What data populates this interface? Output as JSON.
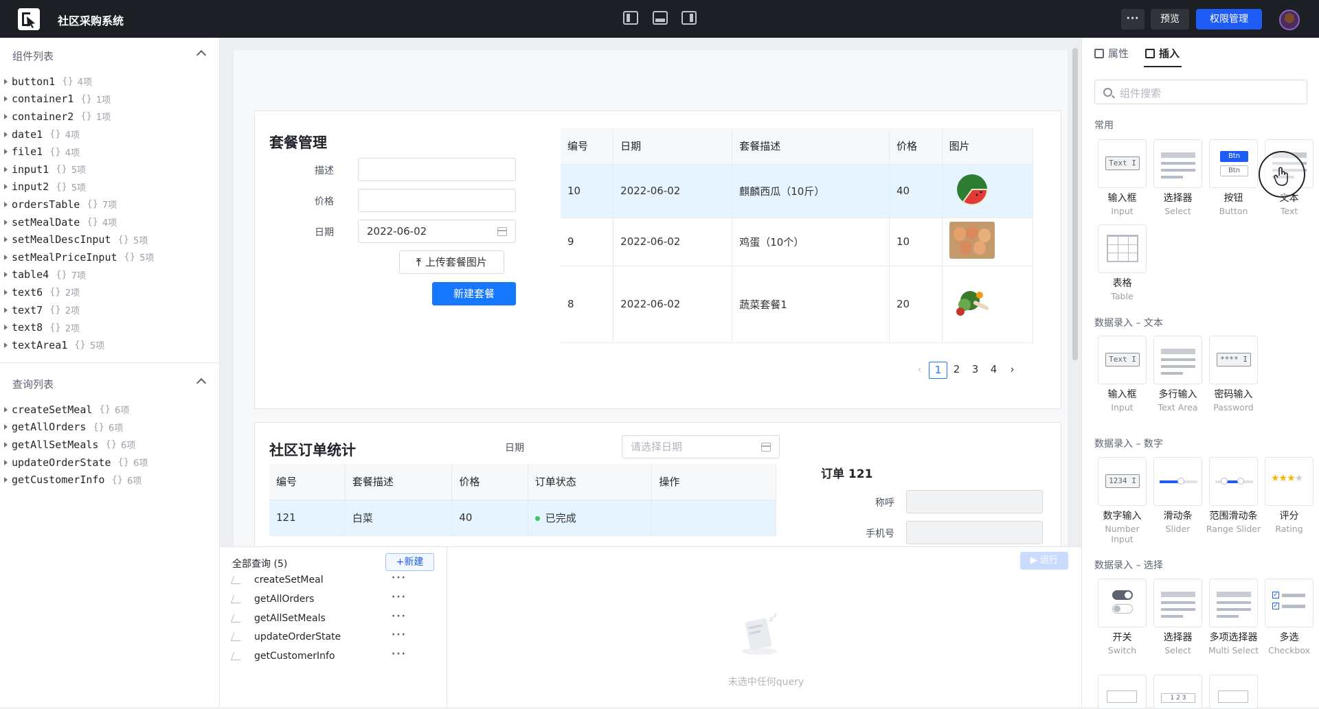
{
  "app": {
    "title": "社区采购系统"
  },
  "topbar": {
    "preview": "预览",
    "permissions": "权限管理",
    "more": "···"
  },
  "left": {
    "components_header": "组件列表",
    "components": [
      {
        "name": "button1",
        "count": "4项"
      },
      {
        "name": "container1",
        "count": "1项"
      },
      {
        "name": "container2",
        "count": "1项"
      },
      {
        "name": "date1",
        "count": "4项"
      },
      {
        "name": "file1",
        "count": "4项"
      },
      {
        "name": "input1",
        "count": "5项"
      },
      {
        "name": "input2",
        "count": "5项"
      },
      {
        "name": "ordersTable",
        "count": "7项"
      },
      {
        "name": "setMealDate",
        "count": "4项"
      },
      {
        "name": "setMealDescInput",
        "count": "5项"
      },
      {
        "name": "setMealPriceInput",
        "count": "5项"
      },
      {
        "name": "table4",
        "count": "7项"
      },
      {
        "name": "text6",
        "count": "2项"
      },
      {
        "name": "text7",
        "count": "2项"
      },
      {
        "name": "text8",
        "count": "2项"
      },
      {
        "name": "textArea1",
        "count": "5项"
      }
    ],
    "queries_header": "查询列表",
    "queries": [
      {
        "name": "createSetMeal",
        "count": "6项"
      },
      {
        "name": "getAllOrders",
        "count": "6项"
      },
      {
        "name": "getAllSetMeals",
        "count": "6项"
      },
      {
        "name": "updateOrderState",
        "count": "6项"
      },
      {
        "name": "getCustomerInfo",
        "count": "6项"
      }
    ],
    "brace": "{}"
  },
  "setmeal": {
    "title": "套餐管理",
    "desc_label": "描述",
    "price_label": "价格",
    "date_label": "日期",
    "date_value": "2022-06-02",
    "upload_label": "上传套餐图片",
    "create_label": "新建套餐",
    "columns": [
      "编号",
      "日期",
      "套餐描述",
      "价格",
      "图片"
    ],
    "rows": [
      {
        "id": "10",
        "date": "2022-06-02",
        "desc": "麒麟西瓜（10斤）",
        "price": "40"
      },
      {
        "id": "9",
        "date": "2022-06-02",
        "desc": "鸡蛋（10个）",
        "price": "10"
      },
      {
        "id": "8",
        "date": "2022-06-02",
        "desc": "蔬菜套餐1",
        "price": "20"
      }
    ],
    "pages": [
      "1",
      "2",
      "3",
      "4"
    ],
    "current_page": "1"
  },
  "orders": {
    "title": "社区订单统计",
    "date_label": "日期",
    "date_placeholder": "请选择日期",
    "columns": [
      "编号",
      "套餐描述",
      "价格",
      "订单状态",
      "操作"
    ],
    "rows": [
      {
        "id": "121",
        "desc": "白菜",
        "price": "40",
        "status": "已完成"
      }
    ],
    "detail_title": "订单 121",
    "name_label": "称呼",
    "phone_label": "手机号"
  },
  "queries_panel": {
    "title": "全部查询 (5)",
    "new_label": "+新建",
    "run_label": "▶ 运行",
    "items": [
      "createSetMeal",
      "getAllOrders",
      "getAllSetMeals",
      "updateOrderState",
      "getCustomerInfo"
    ],
    "empty_text": "未选中任何query"
  },
  "right": {
    "tab_props": "属性",
    "tab_insert": "插入",
    "search_placeholder": "组件搜索",
    "groups": {
      "common": "常用",
      "text_entry": "数据录入 – 文本",
      "number_entry": "数据录入 – 数字",
      "select_entry": "数据录入 – 选择"
    },
    "common": [
      {
        "zh": "输入框",
        "en": "Input",
        "icon": "text-input-icon"
      },
      {
        "zh": "选择器",
        "en": "Select",
        "icon": "select-icon"
      },
      {
        "zh": "按钮",
        "en": "Button",
        "icon": "button-icon"
      },
      {
        "zh": "文本",
        "en": "Text",
        "icon": "text-icon"
      },
      {
        "zh": "表格",
        "en": "Table",
        "icon": "table-icon"
      }
    ],
    "text_entry": [
      {
        "zh": "输入框",
        "en": "Input"
      },
      {
        "zh": "多行输入",
        "en": "Text Area"
      },
      {
        "zh": "密码输入",
        "en": "Password"
      }
    ],
    "number_entry": [
      {
        "zh": "数字输入",
        "en": "Number Input"
      },
      {
        "zh": "滑动条",
        "en": "Slider"
      },
      {
        "zh": "范围滑动条",
        "en": "Range Slider"
      },
      {
        "zh": "评分",
        "en": "Rating"
      }
    ],
    "select_entry": [
      {
        "zh": "开关",
        "en": "Switch"
      },
      {
        "zh": "选择器",
        "en": "Select"
      },
      {
        "zh": "多项选择器",
        "en": "Multi Select"
      },
      {
        "zh": "多选",
        "en": "Checkbox"
      }
    ],
    "glyphs": {
      "text": "Text I",
      "number": "1234 I",
      "password": "**** I",
      "btn": "Btn",
      "pager": "1 2 3"
    }
  },
  "colors": {
    "primary": "#1677ff",
    "topbar": "#1c1f24",
    "selected_row": "#e6f4ff",
    "status_done": "#3cc35c"
  }
}
